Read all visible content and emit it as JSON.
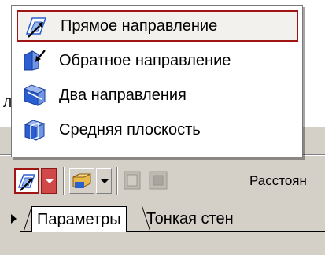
{
  "background": {
    "partial_label": "Ли"
  },
  "menu": {
    "items": [
      {
        "label": "Прямое направление",
        "icon": "forward-direction-icon",
        "selected": true
      },
      {
        "label": "Обратное направление",
        "icon": "reverse-direction-icon",
        "selected": false
      },
      {
        "label": "Два направления",
        "icon": "two-directions-icon",
        "selected": false
      },
      {
        "label": "Средняя плоскость",
        "icon": "middle-plane-icon",
        "selected": false
      }
    ]
  },
  "toolbar": {
    "distance_label": "Расстоян"
  },
  "tabs": {
    "items": [
      {
        "label": "Параметры",
        "active": true
      },
      {
        "label": "Тонкая стен",
        "active": false
      }
    ]
  },
  "colors": {
    "highlight_border": "#a01414",
    "panel_bg": "#d4d0c8",
    "icon_blue": "#2b5fd1",
    "icon_yellow": "#e8b84a"
  }
}
